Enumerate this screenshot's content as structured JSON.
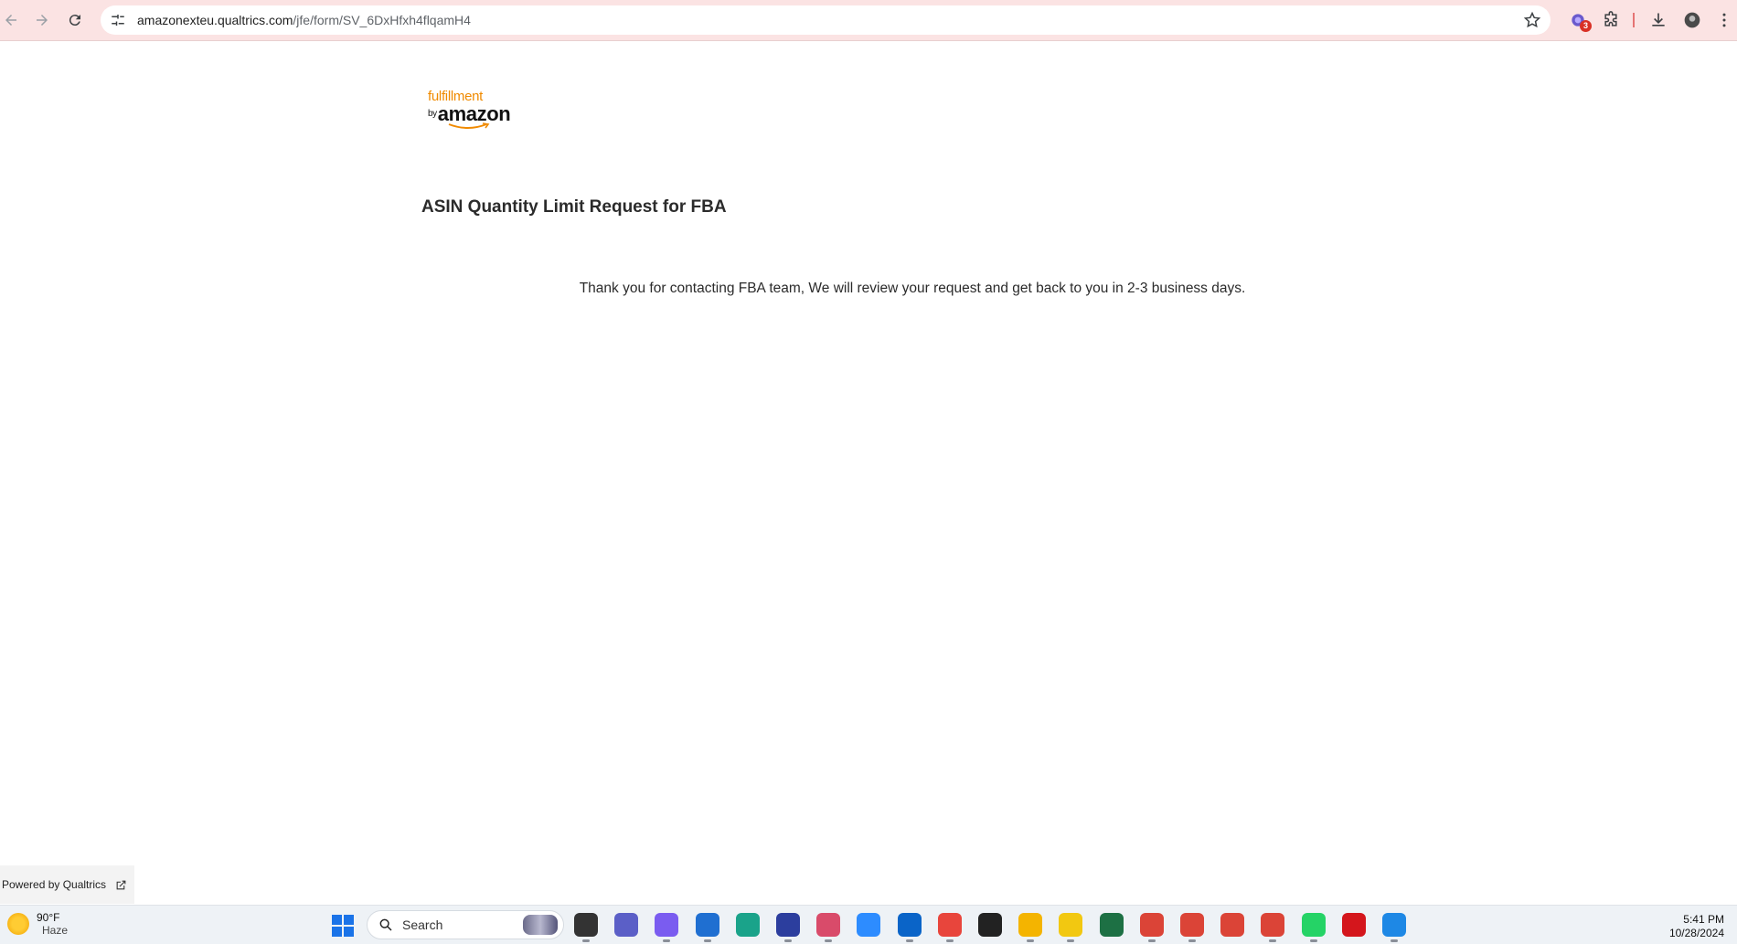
{
  "browser": {
    "url_host": "amazonexteu.qualtrics.com",
    "url_path": "/jfe/form/SV_6DxHfxh4flqamH4",
    "extension_badge": "3"
  },
  "page": {
    "logo_line1": "fulfillment",
    "logo_by": "by",
    "logo_line2": "amazon",
    "title": "ASIN Quantity Limit Request for FBA",
    "message": "Thank you for contacting FBA team, We will review your request and get back to you in 2-3 business days.",
    "powered_by": "Powered by Qualtrics"
  },
  "taskbar": {
    "weather_temp": "90°F",
    "weather_condition": "Haze",
    "search_placeholder": "Search",
    "time": "5:41 PM",
    "date": "10/28/2024",
    "apps": [
      {
        "name": "notepad-app",
        "color": "#333333"
      },
      {
        "name": "teams-app",
        "color": "#5b5fc7"
      },
      {
        "name": "copilot-app",
        "color": "#7a5cf0"
      },
      {
        "name": "edge-dev-app",
        "color": "#1f6fd1"
      },
      {
        "name": "sway-app",
        "color": "#1aa38a"
      },
      {
        "name": "fax-scan-app",
        "color": "#2c3e9e"
      },
      {
        "name": "snipping-tool-app",
        "color": "#d94b6a"
      },
      {
        "name": "zoom-app",
        "color": "#2d8cff"
      },
      {
        "name": "outlook-app",
        "color": "#0a64c8"
      },
      {
        "name": "chrome-app",
        "color": "#e8453c"
      },
      {
        "name": "sticky-notes-app",
        "color": "#222222"
      },
      {
        "name": "file-explorer-app",
        "color": "#f4b400"
      },
      {
        "name": "power-bi-app",
        "color": "#f2c811"
      },
      {
        "name": "excel-app",
        "color": "#1d7044"
      },
      {
        "name": "chrome-profile-1-app",
        "color": "#db4437"
      },
      {
        "name": "chrome-profile-2-app",
        "color": "#db4437"
      },
      {
        "name": "chrome-profile-3-app",
        "color": "#db4437"
      },
      {
        "name": "chrome-profile-4-app",
        "color": "#db4437"
      },
      {
        "name": "whatsapp-app",
        "color": "#25d366"
      },
      {
        "name": "acrobat-app",
        "color": "#d4161c"
      },
      {
        "name": "photos-app",
        "color": "#1e88e5"
      }
    ]
  }
}
